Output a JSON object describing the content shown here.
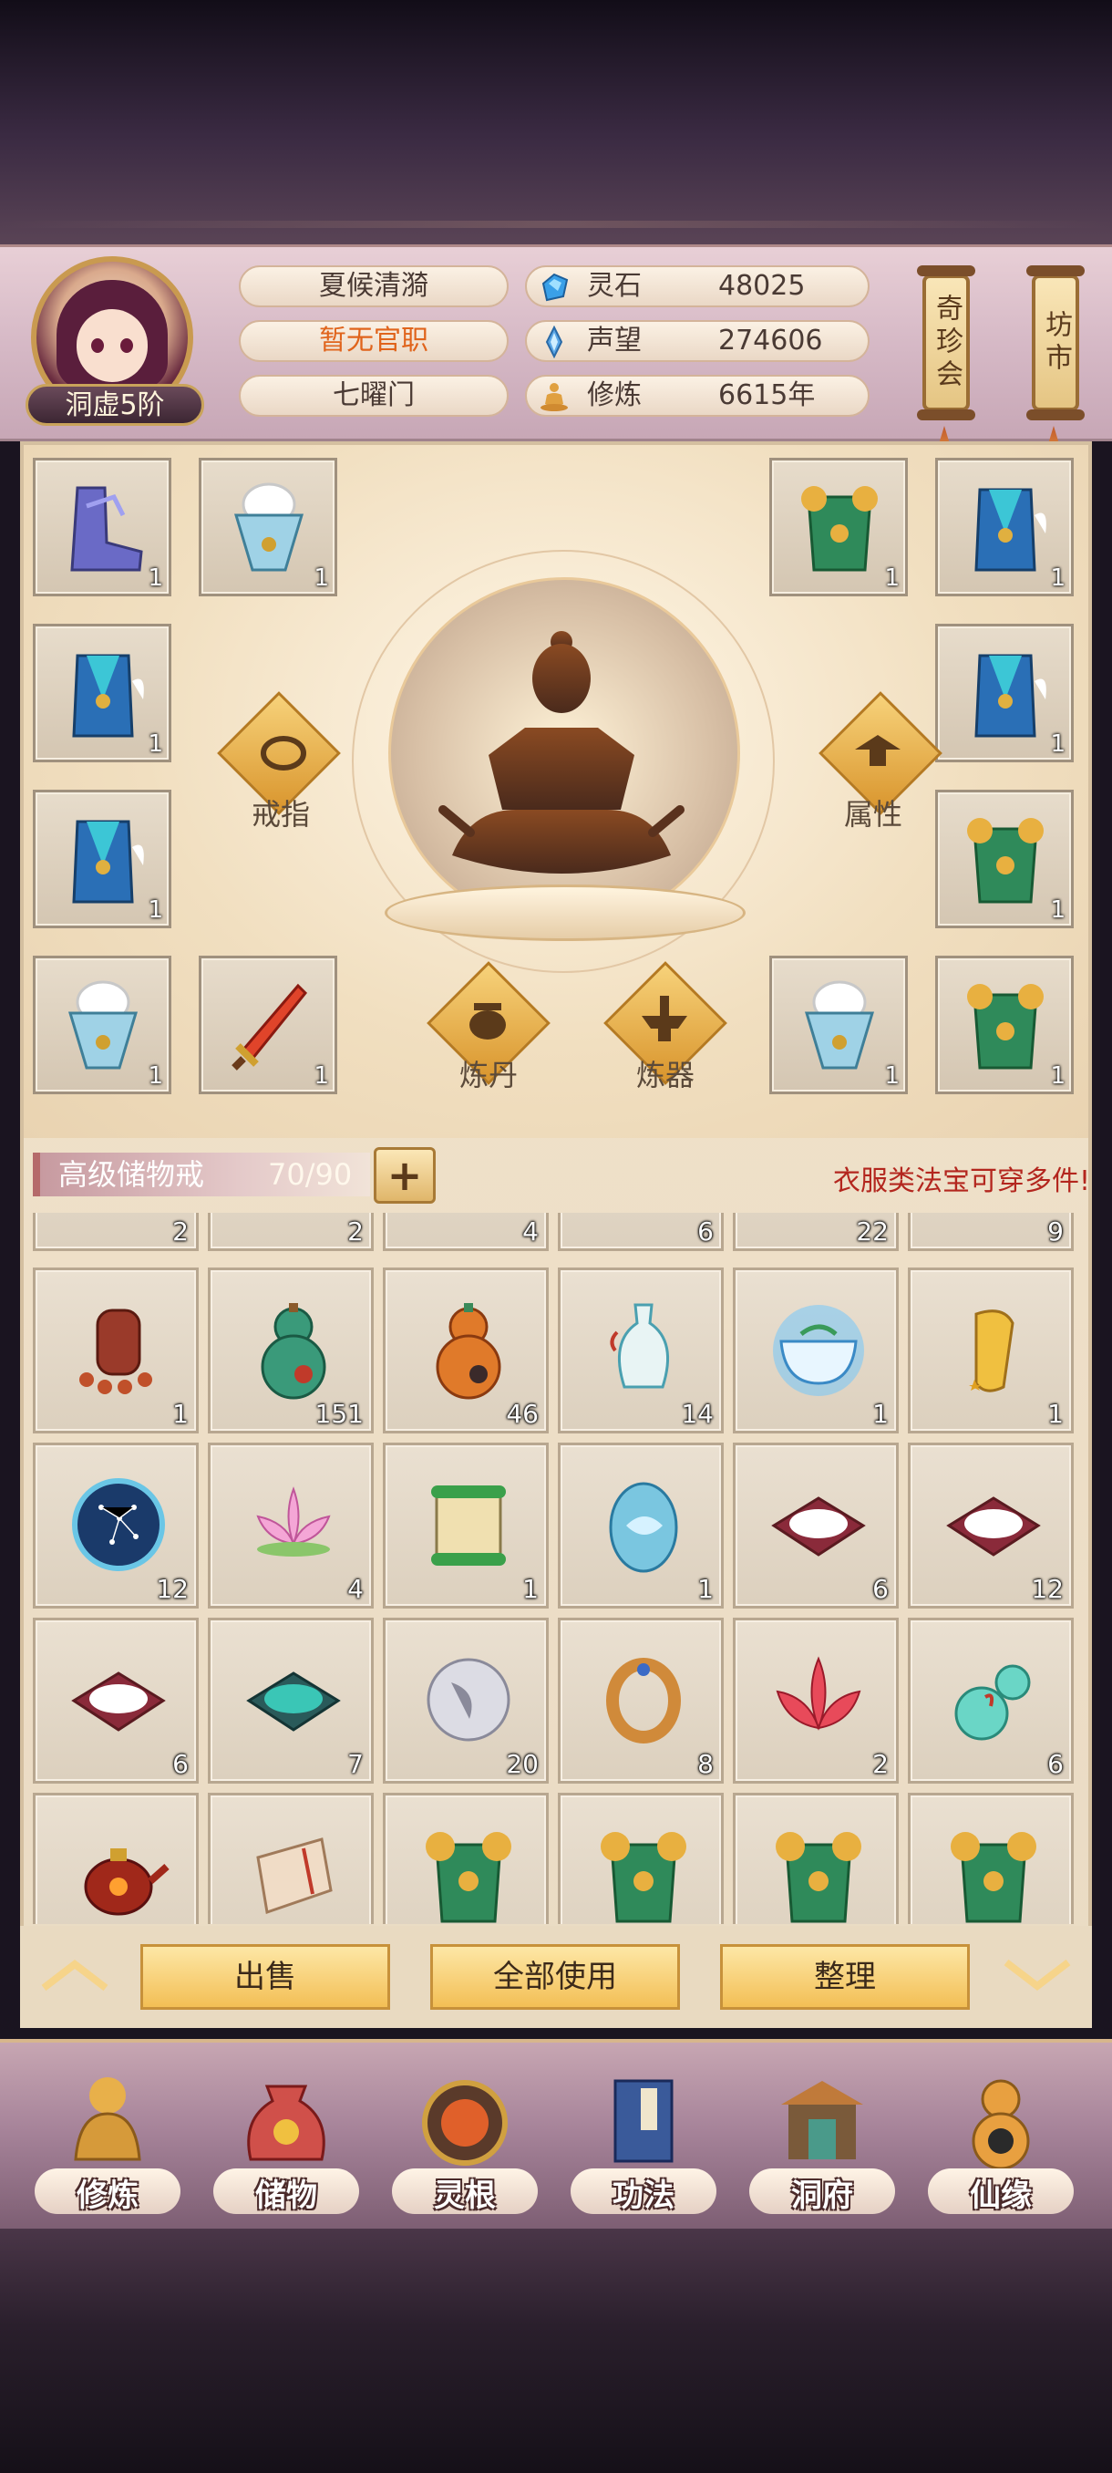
{
  "player": {
    "name": "夏候清漪",
    "official_rank": "暂无官职",
    "sect": "七曜门",
    "realm": "洞虚5阶"
  },
  "stats": [
    {
      "label": "灵石",
      "value": "48025",
      "icon": "spirit-stone-icon",
      "color": "#3aa0e8"
    },
    {
      "label": "声望",
      "value": "274606",
      "icon": "prestige-crystal-icon",
      "color": "#5aa6e6"
    },
    {
      "label": "修炼",
      "value": "6615年",
      "icon": "meditation-icon",
      "color": "#e0a040"
    }
  ],
  "side_buttons": {
    "treasure_fair": "奇珍会",
    "market": "坊市"
  },
  "equip": {
    "ring_label": "戒指",
    "attr_label": "属性",
    "alchemy_label": "炼丹",
    "forge_label": "炼器",
    "left_slots": [
      {
        "icon": "boots-icon",
        "count": "1"
      },
      {
        "icon": "fur-cape-icon",
        "count": "1"
      },
      {
        "icon": "winged-armor-icon",
        "count": "1"
      },
      {
        "icon": "winged-armor-icon",
        "count": "1"
      },
      {
        "icon": "fur-cape-icon",
        "count": "1"
      },
      {
        "icon": "flame-sword-icon",
        "count": "1"
      }
    ],
    "right_slots": [
      {
        "icon": "jade-armor-icon",
        "count": "1"
      },
      {
        "icon": "winged-armor-icon",
        "count": "1"
      },
      {
        "icon": "winged-armor-icon",
        "count": "1"
      },
      {
        "icon": "jade-armor-icon",
        "count": "1"
      },
      {
        "icon": "fur-cape-icon",
        "count": "1"
      },
      {
        "icon": "jade-armor-icon",
        "count": "1"
      }
    ]
  },
  "storage": {
    "title": "高级储物戒",
    "capacity": "70/90",
    "add": "+",
    "tip": "衣服类法宝可穿多件!"
  },
  "items_partial_row": [
    "2",
    "2",
    "4",
    "6",
    "22",
    "9"
  ],
  "items": [
    {
      "icon": "prayer-beads-icon",
      "count": "1"
    },
    {
      "icon": "green-gourd-icon",
      "count": "151"
    },
    {
      "icon": "orange-gourd-icon",
      "count": "46"
    },
    {
      "icon": "elixir-vase-icon",
      "count": "14"
    },
    {
      "icon": "spirit-bowl-icon",
      "count": "1"
    },
    {
      "icon": "golden-scroll-icon",
      "count": "1"
    },
    {
      "icon": "star-compass-icon",
      "count": "12"
    },
    {
      "icon": "pink-lotus-icon",
      "count": "4"
    },
    {
      "icon": "jade-scroll-icon",
      "count": "1"
    },
    {
      "icon": "spirit-egg-icon",
      "count": "1"
    },
    {
      "icon": "white-rice-icon",
      "count": "6"
    },
    {
      "icon": "white-rice-icon",
      "count": "12"
    },
    {
      "icon": "white-rice-icon",
      "count": "6"
    },
    {
      "icon": "jade-beans-icon",
      "count": "7"
    },
    {
      "icon": "silver-orb-icon",
      "count": "20"
    },
    {
      "icon": "gold-ring-icon",
      "count": "8"
    },
    {
      "icon": "red-lotus-icon",
      "count": "2"
    },
    {
      "icon": "jade-gourd-icon",
      "count": "6"
    },
    {
      "icon": "fire-teapot-icon",
      "count": ""
    },
    {
      "icon": "bone-scroll-icon",
      "count": ""
    },
    {
      "icon": "jade-armor-icon",
      "count": ""
    },
    {
      "icon": "jade-armor-icon",
      "count": ""
    },
    {
      "icon": "jade-armor-icon",
      "count": ""
    },
    {
      "icon": "jade-armor-icon",
      "count": ""
    }
  ],
  "actions": {
    "sell": "出售",
    "use_all": "全部使用",
    "sort": "整理"
  },
  "nav": [
    {
      "label": "修炼",
      "icon": "cultivator-icon"
    },
    {
      "label": "储物",
      "icon": "storage-bag-icon"
    },
    {
      "label": "灵根",
      "icon": "spirit-root-icon"
    },
    {
      "label": "功法",
      "icon": "manual-book-icon"
    },
    {
      "label": "洞府",
      "icon": "cave-gate-icon"
    },
    {
      "label": "仙缘",
      "icon": "fate-gourd-icon"
    }
  ]
}
